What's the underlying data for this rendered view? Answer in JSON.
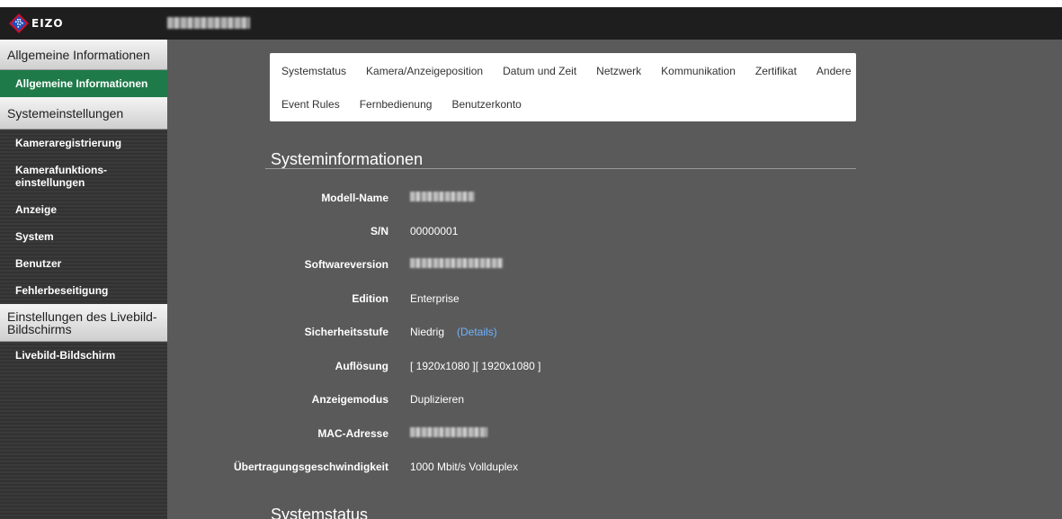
{
  "app": {
    "brand": "EIZO"
  },
  "colors": {
    "topbar": "#1e1e1e",
    "sidebar": "#353535",
    "active": "#1f7a4a",
    "main_bg": "#5a5a5a",
    "link": "#6fb3ff"
  },
  "sidebar": {
    "sections": [
      {
        "title": "Allgemeine Informationen",
        "items": [
          "Allgemeine Informationen"
        ]
      },
      {
        "title": "Systemeinstellungen",
        "items": [
          "Kameraregistrierung",
          "Kamerafunktions-\neinstellungen",
          "Anzeige",
          "System",
          "Benutzer",
          "Fehlerbeseitigung"
        ]
      },
      {
        "title": "Einstellungen des Livebild-\nBildschirms",
        "items": [
          "Livebild-Bildschirm"
        ]
      }
    ]
  },
  "tabs": {
    "row1": [
      "Systemstatus",
      "Kamera/Anzeigeposition",
      "Datum und Zeit",
      "Netzwerk",
      "Kommunikation",
      "Zertifikat",
      "Andere"
    ],
    "row2": [
      "Event Rules",
      "Fernbedienung",
      "Benutzerkonto"
    ]
  },
  "systeminfo": {
    "title": "Systeminformationen",
    "rows": [
      {
        "label": "Modell-Name",
        "value": ""
      },
      {
        "label": "S/N",
        "value": "00000001"
      },
      {
        "label": "Softwareversion",
        "value": ""
      },
      {
        "label": "Edition",
        "value": "Enterprise"
      },
      {
        "label": "Sicherheitsstufe",
        "value": "Niedrig",
        "link": "(Details)"
      },
      {
        "label": "Auflösung",
        "value": "[ 1920x1080 ][ 1920x1080 ]"
      },
      {
        "label": "Anzeigemodus",
        "value": "Duplizieren"
      },
      {
        "label": "MAC-Adresse",
        "value": ""
      },
      {
        "label": "Übertragungsgeschwindigkeit",
        "value": "1000 Mbit/s Vollduplex"
      }
    ]
  },
  "systemstatus": {
    "title": "Systemstatus"
  }
}
